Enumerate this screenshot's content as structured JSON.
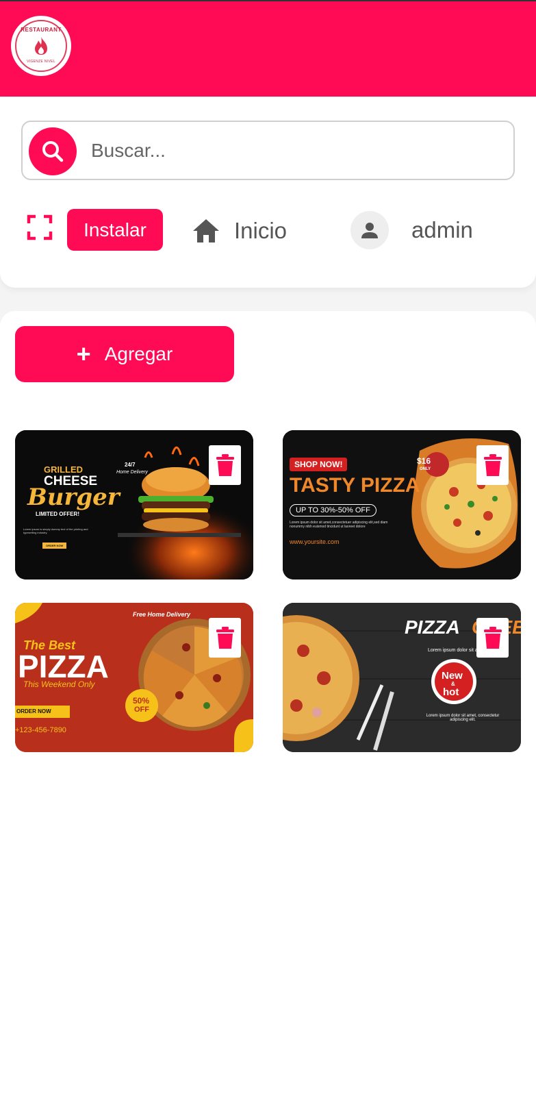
{
  "header": {
    "logo_top_text": "RESTAURANT",
    "logo_bottom_text": "VIGENZE NIVEL"
  },
  "search": {
    "placeholder": "Buscar..."
  },
  "nav": {
    "install_label": "Instalar",
    "home_label": "Inicio",
    "user_label": "admin"
  },
  "actions": {
    "add_label": "Agregar"
  },
  "banners": [
    {
      "title_line1": "GRILLED",
      "title_line2": "CHEESE",
      "title_script": "Burger",
      "subtitle": "LIMITED OFFER!",
      "tag": "24/7",
      "tag2": "Home Delivery",
      "body": "Lorem ipsum is simply dummy text of the printing and typesetting industry.",
      "cta": "ORDER NOW"
    },
    {
      "badge": "SHOP NOW!",
      "title": "TASTY PIZZA",
      "offer": "UP TO 30%-50% OFF",
      "body": "Lorem ipsum dolor sit amet,consectetuer adipiscing elit,sed diam nonummy nibh euismod tincidunt ut laoreet dolore",
      "site": "www.yoursite.com",
      "price": "$16",
      "price_sub": "ONLY"
    },
    {
      "line1": "The Best",
      "line2": "PIZZA",
      "line3": "This Weekend Only",
      "delivery": "Free Home Delivery",
      "cta": "ORDER NOW",
      "phone": "+123-456-7890",
      "discount": "50%",
      "discount_sub": "OFF"
    },
    {
      "title1": "PIZZA",
      "title2": "CHEESE",
      "body_top": "Lorem ipsum dolor sit amet",
      "badge_line1": "New",
      "badge_line2": "&",
      "badge_line3": "hot",
      "body": "Lorem ipsum dolor sit amet, consectetur adipiscing elit."
    }
  ]
}
